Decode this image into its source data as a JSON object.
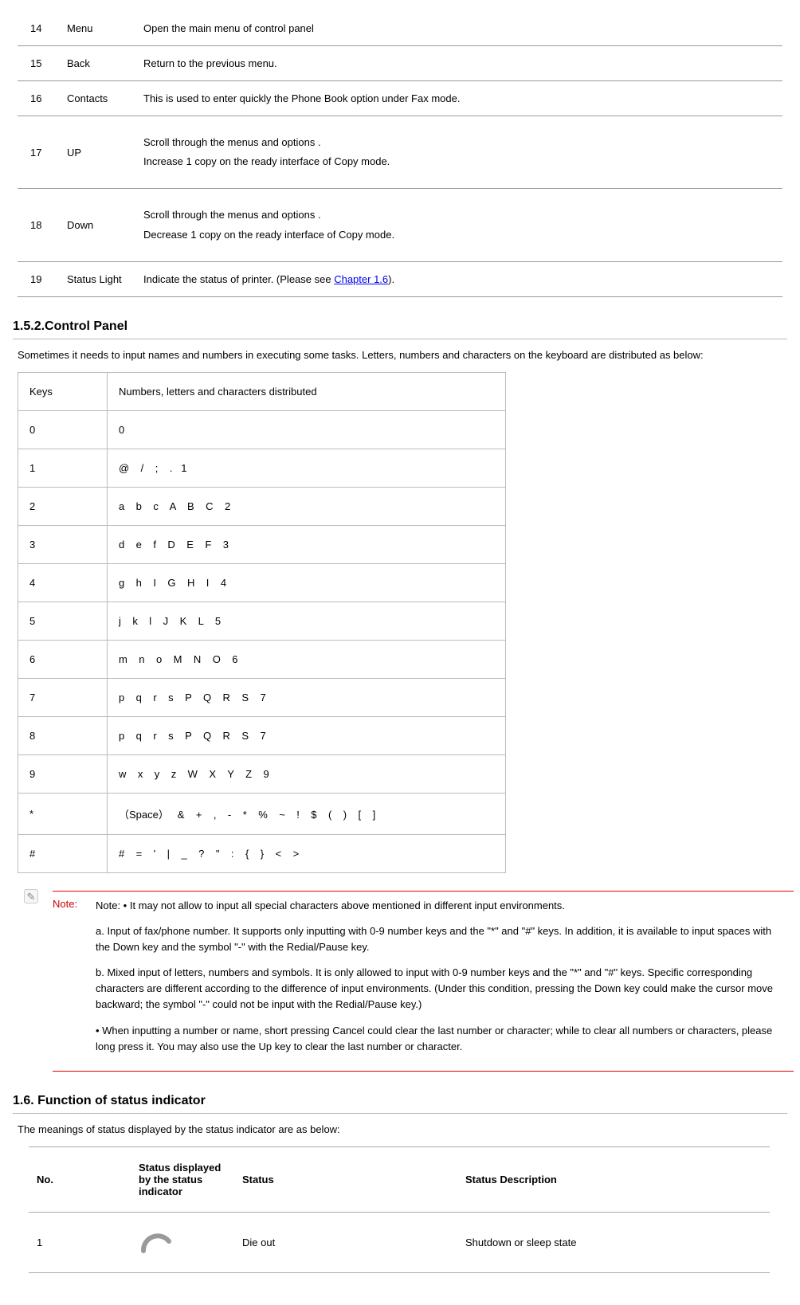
{
  "table1": {
    "rows": [
      {
        "no": "14",
        "name": "Menu",
        "desc": [
          "Open the main menu of control panel"
        ]
      },
      {
        "no": "15",
        "name": "Back",
        "desc": [
          "Return to the previous menu."
        ]
      },
      {
        "no": "16",
        "name": "Contacts",
        "desc": [
          "This is used to enter quickly the Phone Book option under Fax mode."
        ]
      },
      {
        "no": "17",
        "name": "UP",
        "desc": [
          "Scroll through the menus and options .",
          "Increase 1 copy on the ready interface of Copy mode."
        ]
      },
      {
        "no": "18",
        "name": "Down",
        "desc": [
          "Scroll through the menus and options .",
          "Decrease 1 copy on the ready interface of Copy mode."
        ]
      },
      {
        "no": "19",
        "name": "Status Light",
        "desc_pre": "Indicate the status of printer. (Please see ",
        "link_text": "Chapter 1.6",
        "desc_post": ")."
      }
    ]
  },
  "section_152_title": "1.5.2.Control Panel",
  "section_152_intro": "Sometimes it needs to input names and numbers in executing some tasks. Letters, numbers and characters on the keyboard are distributed as below:",
  "table2": {
    "head_keys": "Keys",
    "head_chars": "Numbers, letters and characters distributed",
    "rows": [
      {
        "k": "0",
        "v": "0"
      },
      {
        "k": "1",
        "v": "@    /    ;    .   1"
      },
      {
        "k": "2",
        "v": "a    b    c    A    B    C    2"
      },
      {
        "k": "3",
        "v": "d    e    f    D    E    F    3"
      },
      {
        "k": "4",
        "v": "g    h    I    G    H    I    4"
      },
      {
        "k": "5",
        "v": "j    k    l    J    K    L    5"
      },
      {
        "k": "6",
        "v": "m    n    o    M    N    O    6"
      },
      {
        "k": "7",
        "v": "p    q    r    s    P    Q    R    S    7"
      },
      {
        "k": "8",
        "v": "p    q    r    s    P    Q    R    S    7"
      },
      {
        "k": "9",
        "v": "w    x    y    z    W    X    Y    Z    9"
      },
      {
        "k": "*",
        "v": "（Space）   &    +    ,    -    *    %    ~    !    $    (    )    [    ]"
      },
      {
        "k": "#",
        "v": "#    =    '    |    _    ?    \"    :    {    }    <    >"
      }
    ]
  },
  "note": {
    "label": "Note:",
    "p1": "Note: • It may not allow to input all special characters above mentioned in different input environments.",
    "p2": "a. Input of fax/phone number. It supports only inputting with 0-9 number keys and the \"*\" and \"#\" keys. In addition, it is available to input spaces with the Down key and the symbol \"-\" with the Redial/Pause key.",
    "p3": "b. Mixed input of letters, numbers and symbols. It is only allowed to input with 0-9 number keys and the \"*\" and \"#\" keys. Specific corresponding characters are different according to the difference of input environments. (Under this condition, pressing the Down key could make the cursor move backward; the symbol \"-\" could not be input with the Redial/Pause key.)",
    "p4": "• When inputting a number or name, short pressing Cancel could clear the last number or character; while to clear all numbers or characters, please long press it. You may also use the Up key to clear the last number or character."
  },
  "section_16_title": "1.6. Function of status indicator",
  "section_16_intro": "The meanings of status displayed by the status indicator are as below:",
  "table3": {
    "head": {
      "no": "No.",
      "ind": "Status displayed by the status indicator",
      "stat": "Status",
      "desc": "Status Description"
    },
    "rows": [
      {
        "no": "1",
        "stat": "Die out",
        "desc": "Shutdown or sleep state"
      }
    ]
  }
}
